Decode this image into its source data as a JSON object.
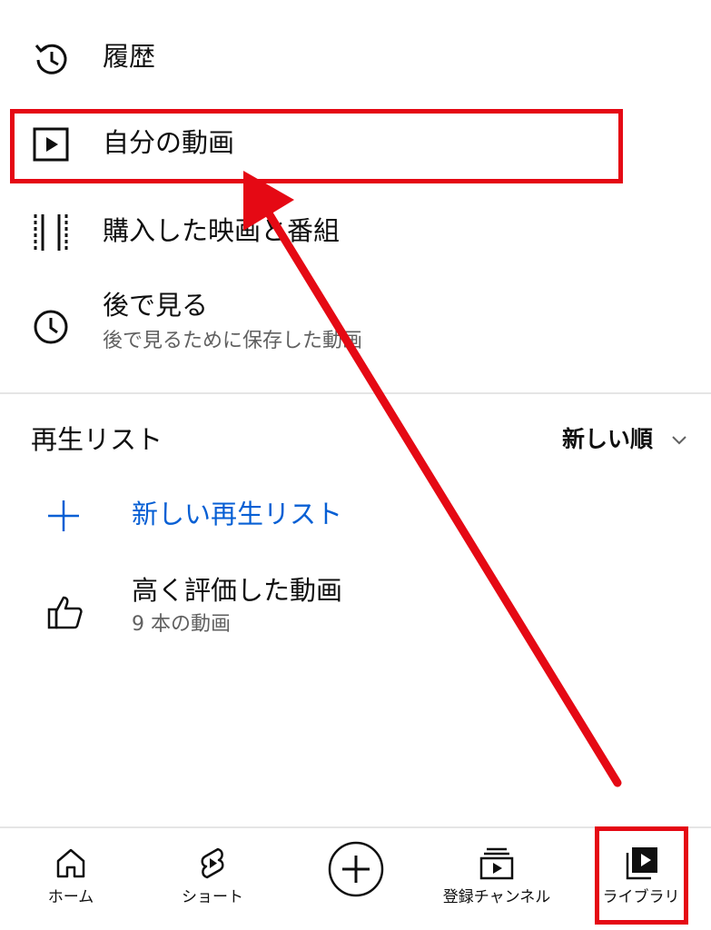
{
  "library_menu": [
    {
      "icon": "history-icon",
      "label": "履歴"
    },
    {
      "icon": "play-square-icon",
      "label": "自分の動画"
    },
    {
      "icon": "film-strip-icon",
      "label": "購入した映画と番組"
    },
    {
      "icon": "clock-icon",
      "label": "後で見る",
      "sub": "後で見るために保存した動画"
    }
  ],
  "playlists": {
    "title": "再生リスト",
    "sort_label": "新しい順",
    "new_playlist_label": "新しい再生リスト",
    "liked": {
      "label": "高く評価した動画",
      "sub": "9 本の動画"
    }
  },
  "bottom_nav": [
    {
      "icon": "home-icon",
      "label": "ホーム"
    },
    {
      "icon": "shorts-icon",
      "label": "ショート"
    },
    {
      "icon": "create-plus-icon",
      "label": ""
    },
    {
      "icon": "subscriptions-icon",
      "label": "登録チャンネル"
    },
    {
      "icon": "library-icon",
      "label": "ライブラリ",
      "active": true
    }
  ],
  "colors": {
    "link_blue": "#065fd4",
    "annotation_red": "#e50914",
    "secondary_text": "#606060"
  }
}
